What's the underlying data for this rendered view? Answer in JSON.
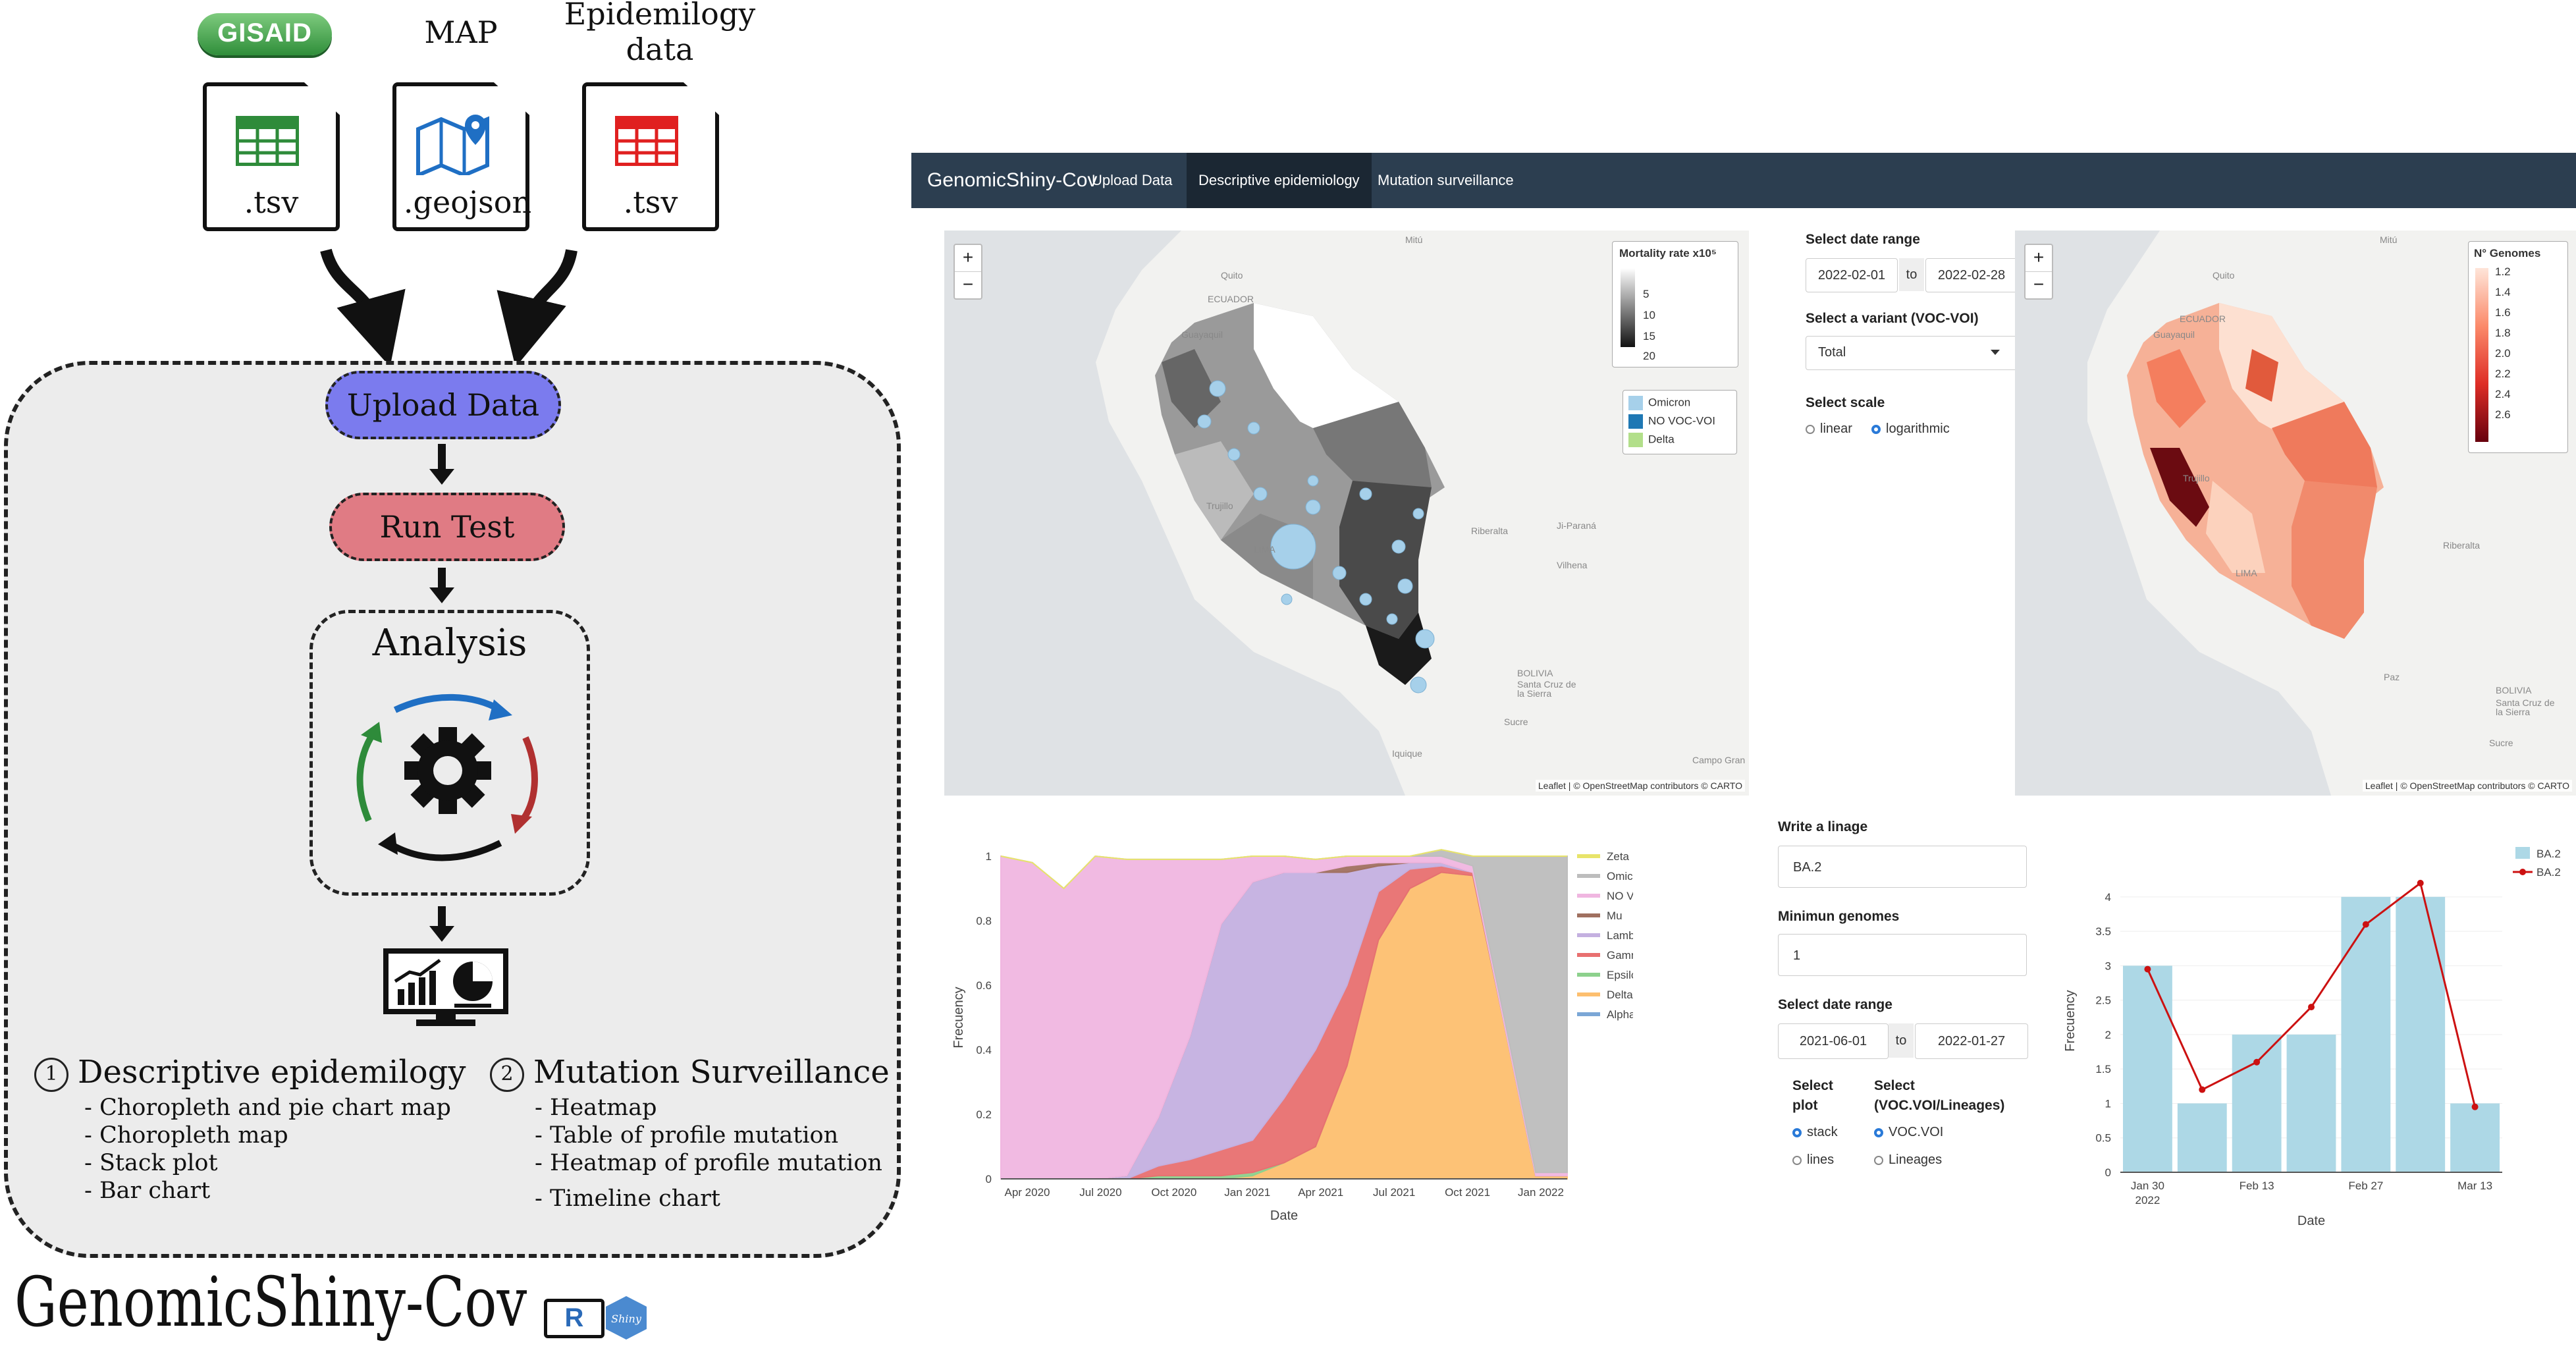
{
  "workflow": {
    "sources": [
      {
        "logo": "GISAID",
        "label": "",
        "ext": ".tsv",
        "icon": "spreadsheet-icon",
        "color": "#2e8b3a"
      },
      {
        "logo": "",
        "label": "MAP",
        "ext": ".geojson",
        "icon": "map-icon",
        "color": "#1f6fc4"
      },
      {
        "logo": "",
        "label": "Epidemilogy data",
        "ext": ".tsv",
        "icon": "spreadsheet-icon",
        "color": "#e02020"
      }
    ],
    "upload": "Upload Data",
    "run": "Run Test",
    "analysis": "Analysis",
    "feature1": {
      "num": "1",
      "title": "Descriptive epidemilogy",
      "items": [
        "- Choropleth and pie chart map",
        "- Choropleth map",
        "- Stack plot",
        "- Bar chart"
      ]
    },
    "feature2": {
      "num": "2",
      "title": "Mutation Surveillance",
      "items": [
        "- Heatmap",
        "- Table of profile mutation",
        "- Heatmap of profile mutation",
        "- Timeline chart"
      ]
    },
    "footer_title": "GenomicShiny-Cov",
    "badges": [
      "R",
      "Shiny"
    ]
  },
  "colors": {
    "upload_fill": "#7b7bee",
    "run_fill": "#e07b84",
    "panel_bg": "#ececec",
    "navbar": "#2c3e50",
    "bar": "#add8e6",
    "line": "#cc1111"
  },
  "app": {
    "brand": "GenomicShiny-Cov",
    "tabs": [
      "Upload Data",
      "Descriptive epidemiology",
      "Mutation surveillance"
    ],
    "active_tab": "Descriptive epidemiology",
    "map1": {
      "legend_title": "Mortality rate x10⁵",
      "legend_ticks": [
        "5",
        "10",
        "15",
        "20"
      ],
      "pie_legend": [
        "Omicron",
        "NO VOC-VOI",
        "Delta"
      ],
      "pie_colors": [
        "#a6d0ea",
        "#1f78b4",
        "#b2df8a"
      ],
      "attribution": "Leaflet | © OpenStreetMap contributors © CARTO",
      "places": [
        "Mitú",
        "Quito",
        "ECUADOR",
        "Guayaquil",
        "Trujillo",
        "LIMA",
        "Ji-Paraná",
        "Riberalta",
        "Vilhena",
        "BOLIVIA",
        "Santa Cruz de la Sierra",
        "Sucre",
        "Iquique",
        "Campo Gran",
        "Paz"
      ]
    },
    "controls1": {
      "date_label": "Select date range",
      "date_start": "2022-02-01",
      "date_sep": "to",
      "date_end": "2022-02-28",
      "variant_label": "Select a variant (VOC-VOI)",
      "variant_value": "Total",
      "scale_label": "Select scale",
      "scale_options": [
        "linear",
        "logarithmic"
      ],
      "scale_selected": "logarithmic"
    },
    "map2": {
      "legend_title": "N° Genomes",
      "legend_ticks": [
        "1.2",
        "1.4",
        "1.6",
        "1.8",
        "2.0",
        "2.2",
        "2.4",
        "2.6"
      ],
      "attribution": "Leaflet | © OpenStreetMap contributors © CARTO"
    },
    "controls2": {
      "lineage_label": "Write a linage",
      "lineage_value": "BA.2",
      "min_label": "Minimun genomes",
      "min_value": "1",
      "date_label": "Select date range",
      "date_start": "2021-06-01",
      "date_sep": "to",
      "date_end": "2022-01-27",
      "plot_label": "Select plot",
      "plot_options": [
        "stack",
        "lines"
      ],
      "plot_selected": "stack",
      "type_label": "Select (VOC.VOI/Lineages)",
      "type_options": [
        "VOC.VOI",
        "Lineages"
      ],
      "type_selected": "VOC.VOI"
    }
  },
  "chart_data": [
    {
      "type": "area",
      "xlabel": "Date",
      "ylabel": "Frecuency",
      "ylim": [
        0,
        1
      ],
      "y_ticks": [
        "0",
        "0.2",
        "0.4",
        "0.6",
        "0.8",
        "1"
      ],
      "x_ticks": [
        "Apr 2020",
        "Jul 2020",
        "Oct 2020",
        "Jan 2021",
        "Apr 2021",
        "Jul 2021",
        "Oct 2021",
        "Jan 2022"
      ],
      "x": [
        "2020-03",
        "2020-06",
        "2020-07",
        "2020-09",
        "2020-12",
        "2021-01",
        "2021-02",
        "2021-03",
        "2021-04",
        "2021-05",
        "2021-06",
        "2021-07",
        "2021-08",
        "2021-09",
        "2021-10",
        "2021-11",
        "2021-12",
        "2022-01",
        "2022-02"
      ],
      "series": [
        {
          "name": "Zeta",
          "color": "#e8e46a",
          "values": [
            0,
            0,
            0,
            0,
            0,
            0,
            0,
            0,
            0,
            0,
            0,
            0,
            0,
            0,
            0,
            0,
            0,
            0,
            0
          ]
        },
        {
          "name": "Omicron",
          "color": "#bdbdbd",
          "values": [
            0,
            0,
            0,
            0,
            0,
            0,
            0,
            0,
            0,
            0,
            0,
            0,
            0,
            0,
            0.02,
            0.03,
            0.5,
            0.98,
            0.98
          ]
        },
        {
          "name": "NO VOC-VOI",
          "color": "#f0b6e0",
          "values": [
            1,
            0.98,
            0.9,
            1,
            0.98,
            0.8,
            0.55,
            0.2,
            0.08,
            0.05,
            0.04,
            0.03,
            0.02,
            0.02,
            0.02,
            0.02,
            0.02,
            0.01,
            0.01
          ]
        },
        {
          "name": "Mu",
          "color": "#a07060",
          "values": [
            0,
            0,
            0,
            0,
            0,
            0,
            0,
            0,
            0,
            0,
            0,
            0.02,
            0.01,
            0,
            0,
            0,
            0,
            0,
            0
          ]
        },
        {
          "name": "Lambda",
          "color": "#c4b0e0",
          "values": [
            0,
            0,
            0,
            0,
            0.01,
            0.15,
            0.38,
            0.7,
            0.8,
            0.7,
            0.55,
            0.35,
            0.08,
            0.02,
            0.01,
            0,
            0,
            0,
            0
          ]
        },
        {
          "name": "Gamma",
          "color": "#e87070",
          "values": [
            0,
            0,
            0,
            0,
            0,
            0.03,
            0.05,
            0.08,
            0.1,
            0.2,
            0.3,
            0.25,
            0.15,
            0.06,
            0.02,
            0.01,
            0,
            0,
            0
          ]
        },
        {
          "name": "Epsilon",
          "color": "#8dd18d",
          "values": [
            0,
            0,
            0,
            0,
            0,
            0.01,
            0.01,
            0.01,
            0.01,
            0,
            0,
            0,
            0,
            0,
            0,
            0,
            0,
            0,
            0
          ]
        },
        {
          "name": "Delta",
          "color": "#fdbf6f",
          "values": [
            0,
            0,
            0,
            0,
            0,
            0,
            0,
            0,
            0.01,
            0.05,
            0.1,
            0.35,
            0.74,
            0.9,
            0.95,
            0.94,
            0.48,
            0.01,
            0.01
          ]
        },
        {
          "name": "Alpha",
          "color": "#7ba7d6",
          "values": [
            0,
            0,
            0,
            0,
            0,
            0,
            0,
            0,
            0,
            0,
            0,
            0,
            0,
            0,
            0,
            0,
            0,
            0,
            0
          ]
        }
      ]
    },
    {
      "type": "bar",
      "xlabel": "Date",
      "ylabel": "Frecuency",
      "ylim": [
        0,
        4.4
      ],
      "y_ticks": [
        "0",
        "0.5",
        "1",
        "1.5",
        "2",
        "2.5",
        "3",
        "3.5",
        "4"
      ],
      "x_ticks": [
        "Jan 30\n2022",
        "Feb 13",
        "Feb 27",
        "Mar 13"
      ],
      "categories": [
        "2022-01-30",
        "2022-02-06",
        "2022-02-13",
        "2022-02-20",
        "2022-02-27",
        "2022-03-06",
        "2022-03-13"
      ],
      "series": [
        {
          "name": "BA.2",
          "kind": "bar",
          "color": "#add8e6",
          "values": [
            3,
            1,
            2,
            2,
            4,
            4,
            1
          ]
        },
        {
          "name": "BA.2",
          "kind": "line",
          "color": "#cc1111",
          "values": [
            2.95,
            1.2,
            1.6,
            2.4,
            3.6,
            4.2,
            0.95
          ]
        }
      ]
    }
  ]
}
